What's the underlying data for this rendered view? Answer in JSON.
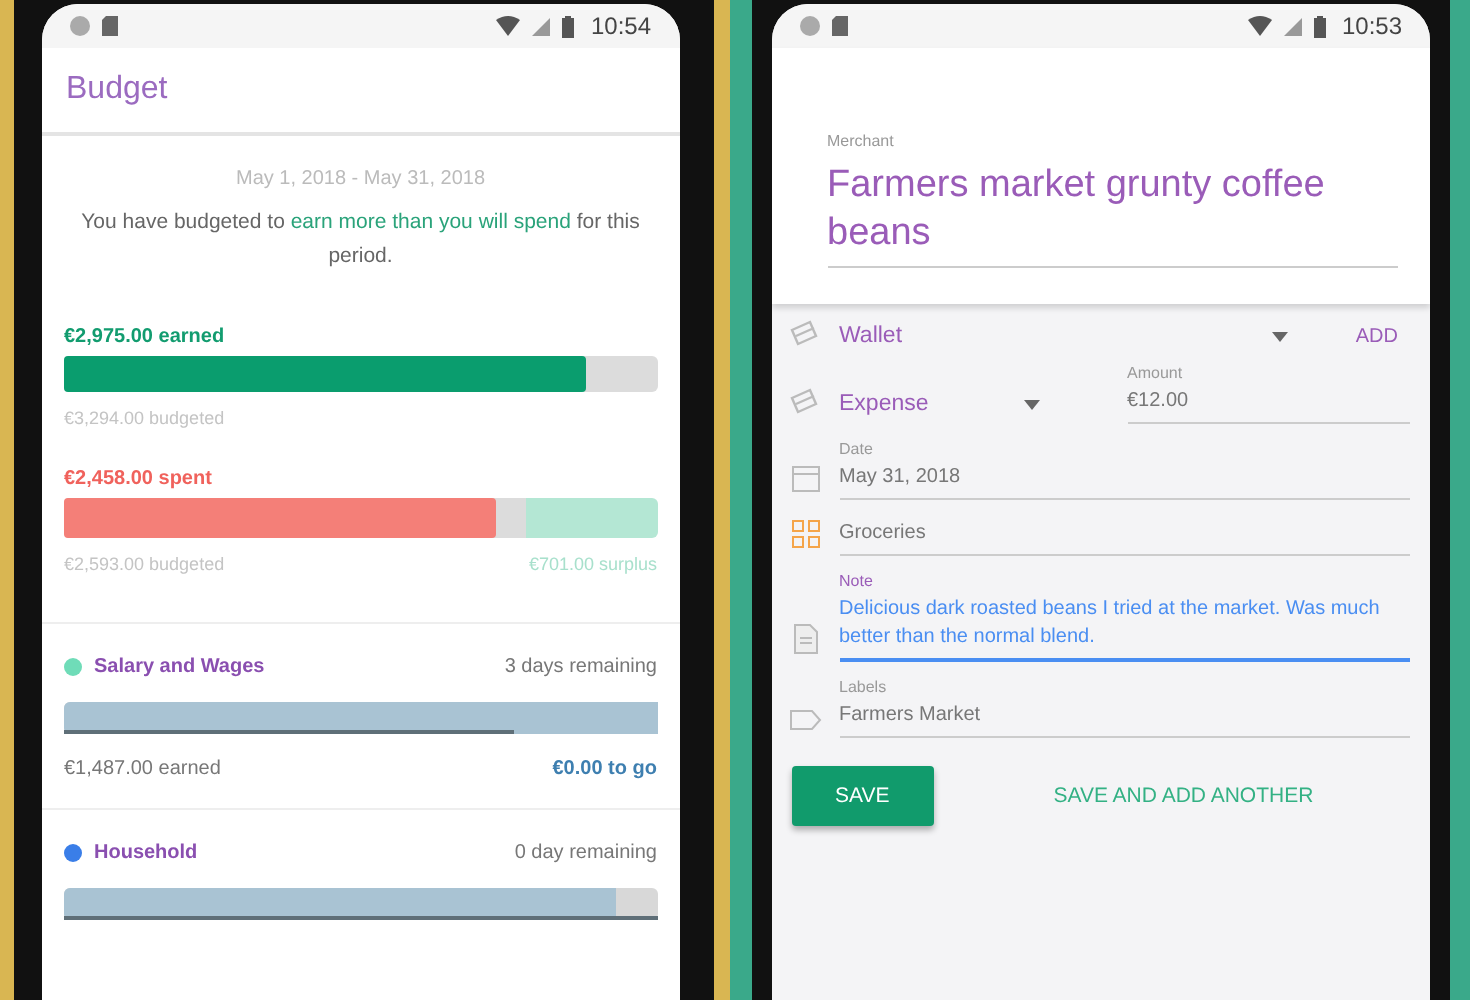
{
  "budget_screen": {
    "status_bar": {
      "time": "10:54"
    },
    "title": "Budget",
    "period": "May 1, 2018 - May 31, 2018",
    "summary": {
      "before": "You have budgeted to ",
      "highlight": "earn more than you will spend",
      "after": " for this period."
    },
    "earned": {
      "amount": "€2,975.00 earned",
      "level": 0.88,
      "budgeted": "€3,294.00 budgeted"
    },
    "spent": {
      "amount": "€2,458.00 spent",
      "level": 0.73,
      "budget": {
        "level": 0.78
      },
      "budgeted": "€2,593.00 budgeted",
      "surplus": "€701.00 surplus"
    },
    "categories": [
      {
        "name": "Salary and Wages",
        "color": "#6fdcb8",
        "remaining": "3 days remaining",
        "level": 1,
        "time": {
          "level": 0.76
        },
        "earned": "€1,487.00 earned",
        "to_go": "€0.00 to go"
      },
      {
        "name": "Household",
        "color": "#3a7ee8",
        "remaining": "0 day remaining",
        "level": 0.93,
        "time": {
          "level": 1
        }
      }
    ]
  },
  "transaction_screen": {
    "status_bar": {
      "time": "10:53"
    },
    "merchant": {
      "label": "Merchant",
      "value": "Farmers market grunty coffee beans"
    },
    "account": {
      "value": "Wallet",
      "action": "ADD"
    },
    "type": {
      "value": "Expense"
    },
    "amount": {
      "label": "Amount",
      "value": "€12.00",
      "focused": false
    },
    "date": {
      "label": "Date",
      "value": "May 31, 2018",
      "focused": false
    },
    "category": {
      "value": "Groceries",
      "focused": false
    },
    "note": {
      "label": "Note",
      "value": "Delicious dark roasted beans I tried at the market. Was much better than the normal blend.",
      "focused": true
    },
    "labels": {
      "label": "Labels",
      "value": "Farmers Market",
      "focused": false
    },
    "buttons": {
      "save": "SAVE",
      "save_another": "SAVE AND ADD ANOTHER"
    }
  }
}
